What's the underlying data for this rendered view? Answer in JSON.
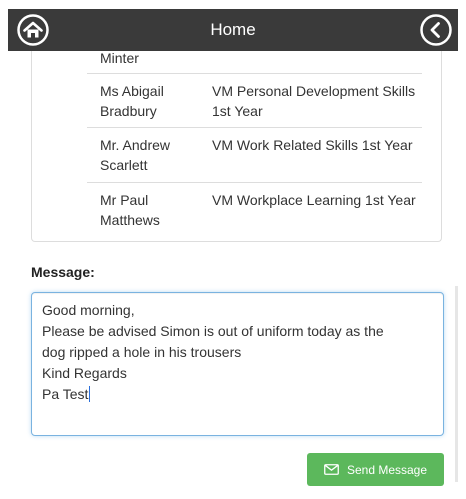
{
  "header": {
    "title": "Home"
  },
  "teachers_table": {
    "rows": [
      {
        "teacher": "Minter",
        "subject": ""
      },
      {
        "teacher": "Ms Abigail Bradbury",
        "subject": "VM Personal Development Skills 1st Year"
      },
      {
        "teacher": "Mr. Andrew Scarlett",
        "subject": "VM Work Related Skills 1st Year"
      },
      {
        "teacher": "Mr Paul Matthews",
        "subject": "VM Workplace Learning 1st Year"
      }
    ]
  },
  "message": {
    "label": "Message:",
    "lines": [
      "Good morning,",
      "Please be advised Simon is out of uniform today as the",
      "dog ripped a hole in his trousers",
      "Kind Regards",
      "Pa Test"
    ]
  },
  "actions": {
    "send_label": "Send Message"
  },
  "colors": {
    "nav_background": "#3a3a3a",
    "send_button": "#5cb85c",
    "input_focus_border": "#7ab3e0"
  },
  "icons": {
    "home": "home-icon",
    "back": "back-chevron-icon",
    "send": "envelope-icon"
  }
}
